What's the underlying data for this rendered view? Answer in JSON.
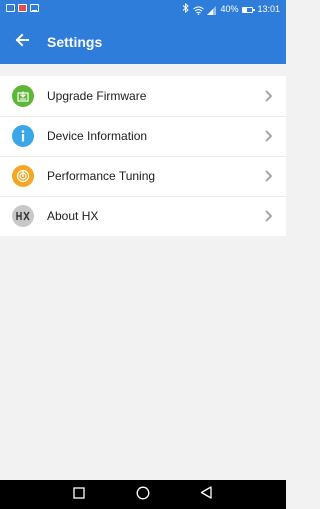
{
  "status_bar": {
    "battery_percent_text": "40%",
    "time": "13:01",
    "left_icons": [
      "notification-square-icon",
      "notification-red-icon",
      "notification-image-icon"
    ],
    "right_icons": [
      "bluetooth-icon",
      "wifi-icon",
      "signal-icon",
      "battery-icon"
    ]
  },
  "app_bar": {
    "title": "Settings",
    "back_icon": "arrow-left-icon"
  },
  "colors": {
    "primary": "#2f7ddb",
    "background": "#f2f2f2",
    "firmware_icon": "#5db734",
    "info_icon": "#3aa7e8",
    "tuning_icon": "#f5a623",
    "about_icon": "#c8c8c8"
  },
  "settings_list": {
    "items": [
      {
        "label": "Upgrade Firmware",
        "icon": "upgrade-firmware-icon"
      },
      {
        "label": "Device Information",
        "icon": "info-icon"
      },
      {
        "label": "Performance Tuning",
        "icon": "performance-tuning-icon"
      },
      {
        "label": "About HX",
        "icon": "hx-logo-icon"
      }
    ]
  },
  "nav_bar": {
    "buttons": [
      "recents-square-icon",
      "home-circle-icon",
      "back-triangle-icon"
    ]
  }
}
